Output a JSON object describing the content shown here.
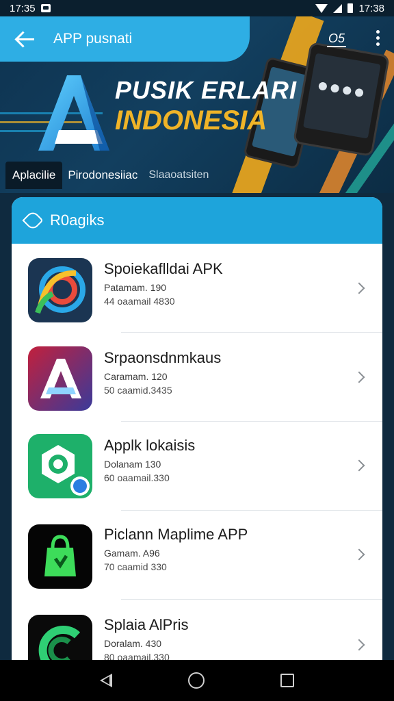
{
  "status_bar": {
    "time_left": "17:35",
    "time_right": "17:38"
  },
  "app_bar": {
    "title": "APP pusnati",
    "badge": "O5"
  },
  "hero": {
    "title_line1": "PUSIK ERLARI",
    "title_line2": "INDONESIA"
  },
  "tabs": [
    {
      "label": "Aplacilie"
    },
    {
      "label": "Pirodonesiiac"
    },
    {
      "label": "Slaaoatsiten"
    }
  ],
  "card": {
    "title": "R0agiks"
  },
  "apps": [
    {
      "name": "Spoiekaflldai APK",
      "meta1": "Patamam. 190",
      "meta2": "44 oaamail 4830",
      "icon": "colorful-swirl-icon"
    },
    {
      "name": "Srpaonsdnmkaus",
      "meta1": "Caramam. 120",
      "meta2": "50 caamid.3435",
      "icon": "letter-a-icon"
    },
    {
      "name": "Applk lokaisis",
      "meta1": "Dolanam 130",
      "meta2": "60 oaamail.330",
      "icon": "hexagon-location-icon"
    },
    {
      "name": "Piclann Maplime APP",
      "meta1": "Gamam. A96",
      "meta2": "70 caamid 330",
      "icon": "green-bag-icon"
    },
    {
      "name": "Splaia AlPris",
      "meta1": "Doralam. 430",
      "meta2": "80 oaamail.330",
      "icon": "green-c-icon"
    }
  ],
  "colors": {
    "accent": "#1ea4db",
    "hero_gold": "#f0b428",
    "background": "#0f2a3f"
  }
}
